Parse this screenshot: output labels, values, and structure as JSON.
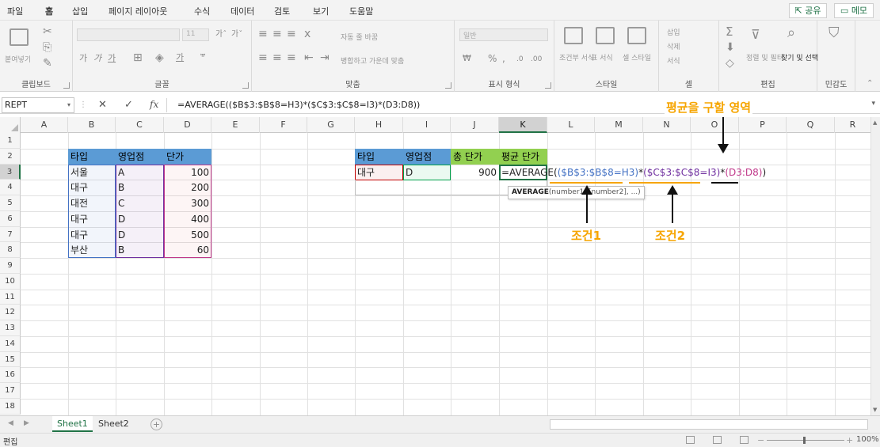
{
  "ribbon_tabs": [
    "파일",
    "홈",
    "삽입",
    "페이지 레이아웃",
    "수식",
    "데이터",
    "검토",
    "보기",
    "도움말"
  ],
  "share_label": "공유",
  "memo_label": "메모",
  "ribbon": {
    "clipboard": {
      "label": "클립보드",
      "paste": "붙여넣기"
    },
    "font": {
      "label": "글꼴",
      "size": "11"
    },
    "alignment": {
      "label": "맞춤",
      "wrap": "자동 줄 바꿈",
      "merge": "병합하고 가운데 맞춤"
    },
    "number": {
      "label": "표시 형식",
      "format": "일반"
    },
    "styles": {
      "label": "스타일",
      "conditional": "조건부 서식",
      "table": "표 서식",
      "cell": "셀 스타일"
    },
    "cells": {
      "label": "셀",
      "insert": "삽입",
      "delete": "삭제",
      "format": "서식"
    },
    "editing": {
      "label": "편집",
      "sort": "정렬 및 필터",
      "find": "찾기 및 선택"
    },
    "sensitivity": {
      "label": "민감도"
    }
  },
  "formula_bar": {
    "name_box": "REPT",
    "formula": "=AVERAGE(($B$3:$B$8=H3)*($C$3:$C$8=I3)*(D3:D8))"
  },
  "columns": [
    "A",
    "B",
    "C",
    "D",
    "E",
    "F",
    "G",
    "H",
    "I",
    "J",
    "K",
    "L",
    "M",
    "N",
    "O",
    "P",
    "Q",
    "R"
  ],
  "rows": [
    "1",
    "2",
    "3",
    "4",
    "5",
    "6",
    "7",
    "8",
    "9",
    "10",
    "11",
    "12",
    "13",
    "14",
    "15",
    "16",
    "17",
    "18"
  ],
  "table1": {
    "headers": [
      "타입",
      "영업점",
      "단가"
    ],
    "rows": [
      [
        "서울",
        "A",
        "100"
      ],
      [
        "대구",
        "B",
        "200"
      ],
      [
        "대전",
        "C",
        "300"
      ],
      [
        "대구",
        "D",
        "400"
      ],
      [
        "대구",
        "D",
        "500"
      ],
      [
        "부산",
        "B",
        "60"
      ]
    ]
  },
  "table2": {
    "headers": [
      "타입",
      "영업점",
      "총 단가",
      "평균 단가"
    ],
    "row": [
      "대구",
      "D",
      "900"
    ]
  },
  "editing_cell": {
    "prefix": "=AVERAGE(",
    "part1": "($B$3:$B$8=H3)",
    "star1": "*",
    "part2": "($C$3:$C$8=I3)",
    "star2": "*",
    "part3": "(D3:D8)",
    "suffix": ")"
  },
  "tooltip": {
    "func": "AVERAGE",
    "args": "(number1, [number2], ...)"
  },
  "annotations": {
    "area": "평균을 구할 영역",
    "cond1": "조건1",
    "cond2": "조건2"
  },
  "sheets": [
    "Sheet1",
    "Sheet2"
  ],
  "status": "편집",
  "zoom": "100%",
  "colors": {
    "header_blue": "#5b9bd5",
    "header_green": "#92d050",
    "annotation": "#f6a500",
    "excel_green": "#217346",
    "ref_blue": "#4472c4",
    "ref_purple": "#7030a0",
    "ref_red": "#c00000"
  }
}
